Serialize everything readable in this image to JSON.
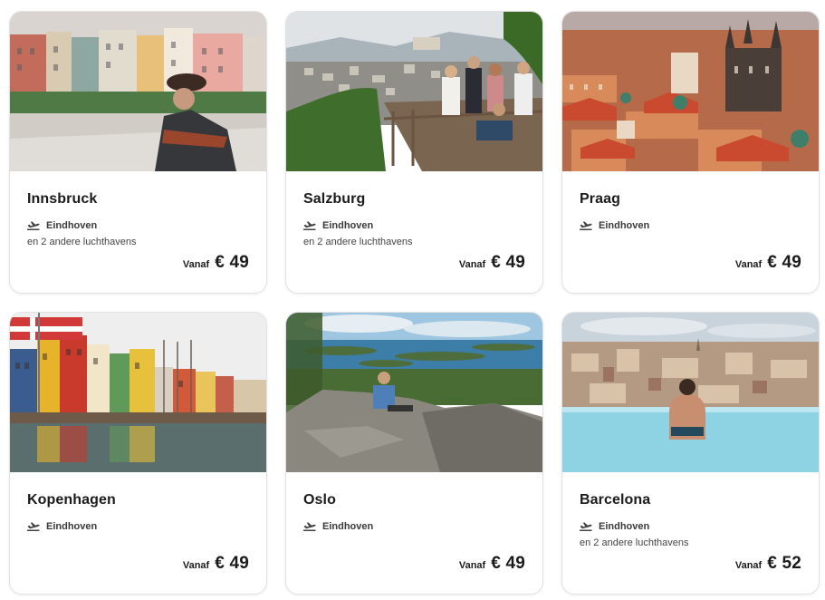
{
  "cards": [
    {
      "city": "Innsbruck",
      "airport": "Eindhoven",
      "other_airports": "en 2 andere luchthavens",
      "from_label": "Vanaf",
      "price": "€ 49",
      "icon": "plane-departure-icon"
    },
    {
      "city": "Salzburg",
      "airport": "Eindhoven",
      "other_airports": "en 2 andere luchthavens",
      "from_label": "Vanaf",
      "price": "€ 49",
      "icon": "plane-departure-icon"
    },
    {
      "city": "Praag",
      "airport": "Eindhoven",
      "other_airports": "",
      "from_label": "Vanaf",
      "price": "€ 49",
      "icon": "plane-departure-icon"
    },
    {
      "city": "Kopenhagen",
      "airport": "Eindhoven",
      "other_airports": "",
      "from_label": "Vanaf",
      "price": "€ 49",
      "icon": "plane-departure-icon"
    },
    {
      "city": "Oslo",
      "airport": "Eindhoven",
      "other_airports": "",
      "from_label": "Vanaf",
      "price": "€ 49",
      "icon": "plane-departure-icon"
    },
    {
      "city": "Barcelona",
      "airport": "Eindhoven",
      "other_airports": "en 2 andere luchthavens",
      "from_label": "Vanaf",
      "price": "€ 52",
      "icon": "plane-departure-icon"
    }
  ]
}
